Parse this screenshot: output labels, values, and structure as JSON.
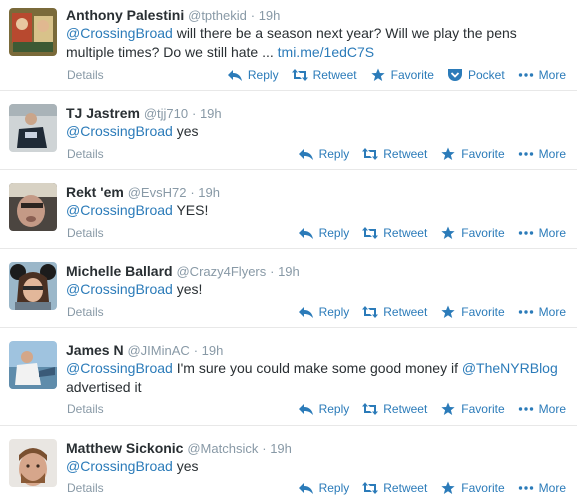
{
  "actions": {
    "details": "Details",
    "reply": "Reply",
    "retweet": "Retweet",
    "favorite": "Favorite",
    "pocket": "Pocket",
    "more": "More"
  },
  "colors": {
    "link": "#2b7bb9",
    "muted": "#8899a6",
    "text": "#292f33"
  },
  "tweets": [
    {
      "name": "Anthony Palestini",
      "handle": "@tpthekid",
      "time": "· 19h",
      "mention": "@CrossingBroad",
      "text_line1": " will there be a season next year? Will we play the pens",
      "text_line2": "multiple times? Do we still hate ... ",
      "link": "tmi.me/1edC7S"
    },
    {
      "name": "TJ Jastrem",
      "handle": "@tjj710",
      "time": "· 19h",
      "mention": "@CrossingBroad",
      "text": " yes"
    },
    {
      "name": "Rekt 'em",
      "handle": "@EvsH72",
      "time": "· 19h",
      "mention": "@CrossingBroad",
      "text": " YES!"
    },
    {
      "name": "Michelle Ballard",
      "handle": "@Crazy4Flyers",
      "time": "· 19h",
      "mention": "@CrossingBroad",
      "text": " yes!"
    },
    {
      "name": "James N",
      "handle": "@JIMinAC",
      "time": "· 19h",
      "mention": "@CrossingBroad",
      "text_line1": " I'm sure you could make some good money if ",
      "mention2": "@TheNYRBlog",
      "text_line2": "advertised it"
    },
    {
      "name": "Matthew Sickonic",
      "handle": "@Matchsick",
      "time": "· 19h",
      "mention": "@CrossingBroad",
      "text": " yes"
    }
  ]
}
